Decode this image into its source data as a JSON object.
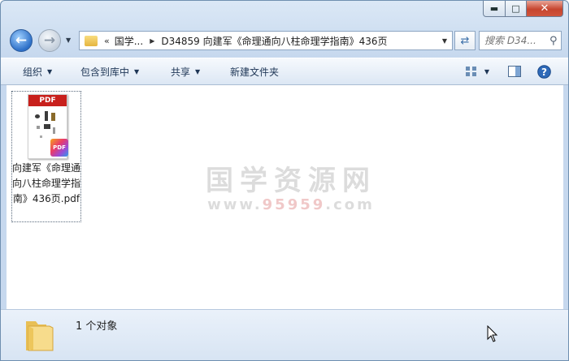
{
  "window": {
    "minimize_icon": "minimize-icon",
    "maximize_icon": "maximize-icon",
    "close_icon": "close-icon"
  },
  "nav": {
    "back_icon": "arrow-left-icon",
    "forward_icon": "arrow-right-icon"
  },
  "address": {
    "overflow": "«",
    "crumbs": [
      "国学...",
      "D34859 向建军《命理通向八柱命理学指南》436页"
    ]
  },
  "search": {
    "placeholder": "搜索 D34..."
  },
  "toolbar": {
    "organize": "组织",
    "include_library": "包含到库中",
    "share": "共享",
    "new_folder": "新建文件夹"
  },
  "file": {
    "name": "向建军《命理通向八柱命理学指南》436页.pdf",
    "thumb_label": "PDF",
    "badge": "PDF"
  },
  "watermark": {
    "line1": "国学资源网",
    "line2_a": "www.",
    "line2_b": "95959",
    "line2_c": ".com"
  },
  "details": {
    "count": "1 个对象"
  }
}
